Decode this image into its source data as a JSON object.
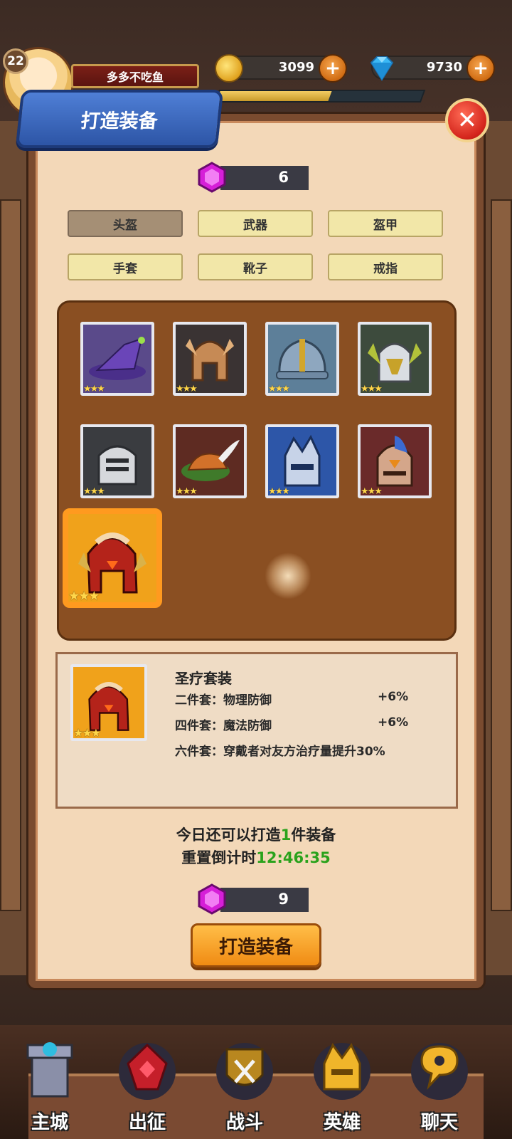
{
  "hud": {
    "level": "22",
    "player_name": "多多不吃鱼",
    "gold": "3099",
    "diamonds": "9730",
    "exp_progress": 0.55
  },
  "modal": {
    "title": "打造装备",
    "close_icon": "close-icon"
  },
  "material_top": {
    "count": "6",
    "icon": "purple-gem-icon"
  },
  "tabs": [
    {
      "label": "头盔",
      "active": true
    },
    {
      "label": "武器",
      "active": false
    },
    {
      "label": "盔甲",
      "active": false
    },
    {
      "label": "手套",
      "active": false
    },
    {
      "label": "靴子",
      "active": false
    },
    {
      "label": "戒指",
      "active": false
    }
  ],
  "equipment": [
    {
      "name": "wizard-hat-icon",
      "stars": "★★★"
    },
    {
      "name": "bronze-winged-helmet-icon",
      "stars": "★★★"
    },
    {
      "name": "steel-kettle-helmet-icon",
      "stars": "★★★"
    },
    {
      "name": "gold-silver-winged-helmet-icon",
      "stars": "★★★"
    },
    {
      "name": "knight-visor-helmet-icon",
      "stars": "★★★"
    },
    {
      "name": "feathered-hunter-hat-icon",
      "stars": "★★★"
    },
    {
      "name": "spiked-blue-helmet-icon",
      "stars": "★★★"
    },
    {
      "name": "blue-crest-helmet-icon",
      "stars": "★★★"
    },
    {
      "name": "crimson-holy-helmet-icon",
      "stars": "★★★",
      "selected": true
    }
  ],
  "set_info": {
    "name": "圣疗套装",
    "lines": [
      {
        "label": "二件套：物理防御",
        "value": "+6%"
      },
      {
        "label": "四件套：魔法防御",
        "value": "+6%"
      },
      {
        "label": "六件套：穿戴者对友方治疗量提升30%",
        "value": ""
      }
    ],
    "stars": "★★★"
  },
  "daily": {
    "prefix": "今日还可以打造",
    "count": "1",
    "suffix": "件装备",
    "reset_label": "重置倒计时",
    "countdown": "12:46:35"
  },
  "cost": {
    "count": "9",
    "icon": "purple-gem-icon"
  },
  "craft_button": "打造装备",
  "nav": [
    {
      "label": "主城",
      "icon": "castle-tower-icon"
    },
    {
      "label": "出征",
      "icon": "red-crystal-icon"
    },
    {
      "label": "战斗",
      "icon": "crossed-swords-shield-icon"
    },
    {
      "label": "英雄",
      "icon": "golden-helmet-icon"
    },
    {
      "label": "聊天",
      "icon": "chat-bubble-icon"
    }
  ],
  "colors": {
    "modal_bg": "#f3d8b8",
    "panel_brown": "#8a4f22",
    "title_blue": "#2d55a6",
    "accent_orange": "#f08b13",
    "green_text": "#2aa21c"
  }
}
